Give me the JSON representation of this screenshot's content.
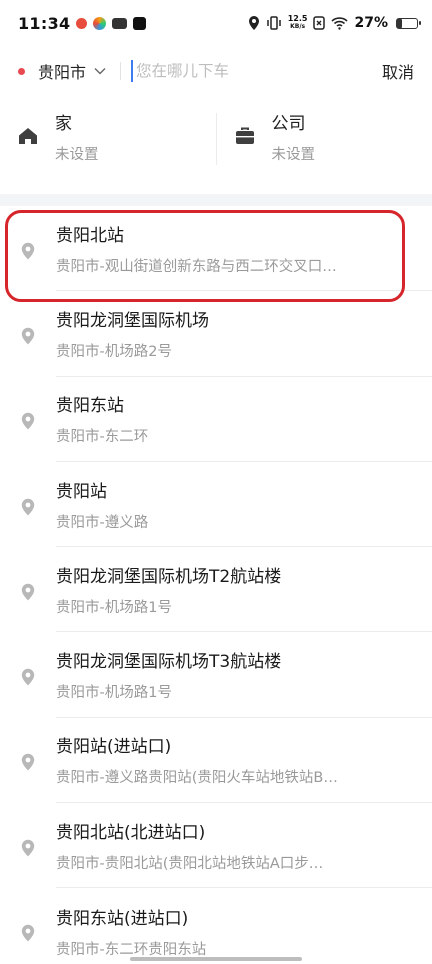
{
  "status": {
    "time": "11:34",
    "speed_top": "12.5",
    "speed_bottom": "KB/s",
    "battery": "27%",
    "battery_level": 0.27
  },
  "search": {
    "city": "贵阳市",
    "placeholder": "您在哪儿下车",
    "cancel": "取消"
  },
  "shortcuts": [
    {
      "title": "家",
      "subtitle": "未设置",
      "icon": "home-icon"
    },
    {
      "title": "公司",
      "subtitle": "未设置",
      "icon": "briefcase-icon"
    }
  ],
  "results": [
    {
      "name": "贵阳北站",
      "address": "贵阳市-观山街道创新东路与西二环交叉口…",
      "highlighted": true
    },
    {
      "name": "贵阳龙洞堡国际机场",
      "address": "贵阳市-机场路2号"
    },
    {
      "name": "贵阳东站",
      "address": "贵阳市-东二环"
    },
    {
      "name": "贵阳站",
      "address": "贵阳市-遵义路"
    },
    {
      "name": "贵阳龙洞堡国际机场T2航站楼",
      "address": "贵阳市-机场路1号"
    },
    {
      "name": "贵阳龙洞堡国际机场T3航站楼",
      "address": "贵阳市-机场路1号"
    },
    {
      "name": "贵阳站(进站口)",
      "address": "贵阳市-遵义路贵阳站(贵阳火车站地铁站B…"
    },
    {
      "name": "贵阳北站(北进站口)",
      "address": "贵阳市-贵阳北站(贵阳北站地铁站A口步…"
    },
    {
      "name": "贵阳东站(进站口)",
      "address": "贵阳市-东二环贵阳东站"
    }
  ],
  "colors": {
    "accent": "#3d7cf0",
    "city_dot": "#e8484f",
    "highlight": "#d6252b",
    "pin": "#b8b8b8"
  }
}
